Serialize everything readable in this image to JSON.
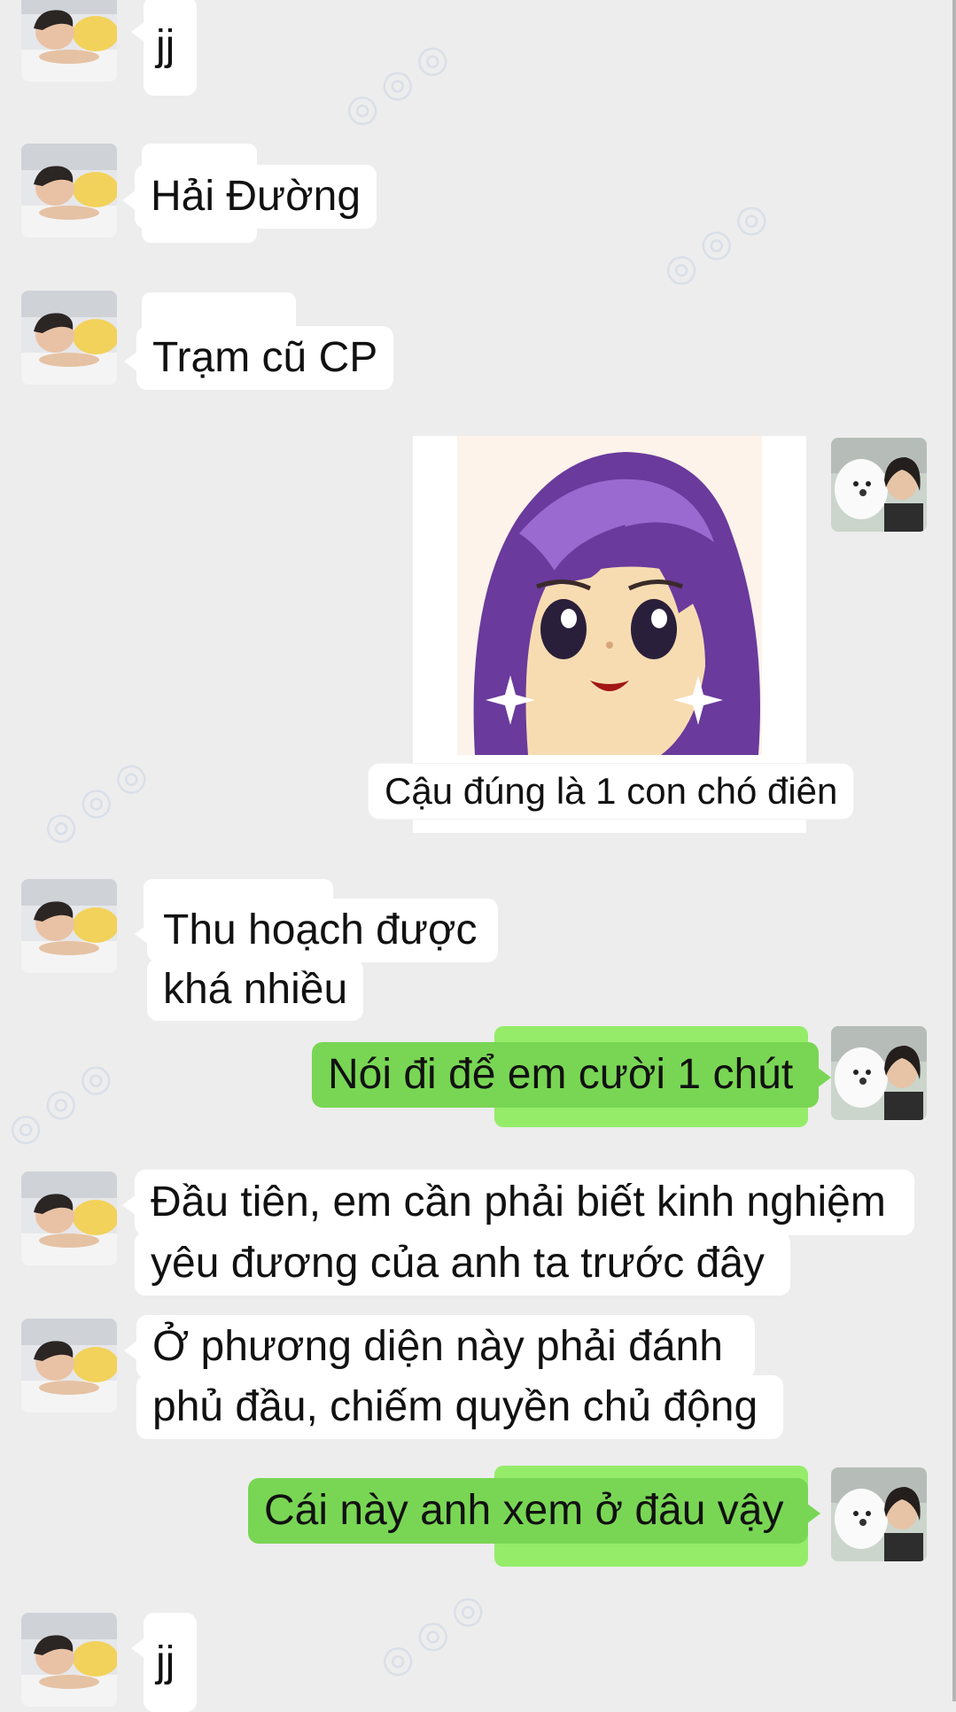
{
  "chat": {
    "messages": [
      {
        "sender": "them",
        "text": "jj"
      },
      {
        "sender": "them",
        "text": "Hải Đường"
      },
      {
        "sender": "them",
        "text": "Trạm cũ CP"
      },
      {
        "sender": "me",
        "type": "sticker",
        "sticker_icon": "anime-girl-sticker",
        "caption": "Cậu đúng là 1 con chó điên"
      },
      {
        "sender": "them",
        "lines": [
          "Thu hoạch được",
          "khá nhiều"
        ]
      },
      {
        "sender": "me",
        "text": "Nói đi để em cười 1 chút"
      },
      {
        "sender": "them",
        "lines": [
          "Đầu tiên, em cần phải biết kinh nghiệm",
          "yêu đương của anh ta trước đây"
        ]
      },
      {
        "sender": "them",
        "lines": [
          "Ở phương diện này phải đánh",
          "phủ đầu, chiếm quyền chủ động"
        ]
      },
      {
        "sender": "me",
        "text": "Cái này anh xem ở đâu vậy"
      },
      {
        "sender": "them",
        "text": "jj"
      }
    ]
  },
  "avatars": {
    "them_icon": "boy-lying-avatar-icon",
    "me_icon": "person-with-white-dog-avatar-icon"
  },
  "colors": {
    "background": "#ededed",
    "incoming_bubble": "#ffffff",
    "outgoing_bubble": "#95ec69",
    "outgoing_bubble_edge": "#79d654",
    "text": "#111111"
  }
}
